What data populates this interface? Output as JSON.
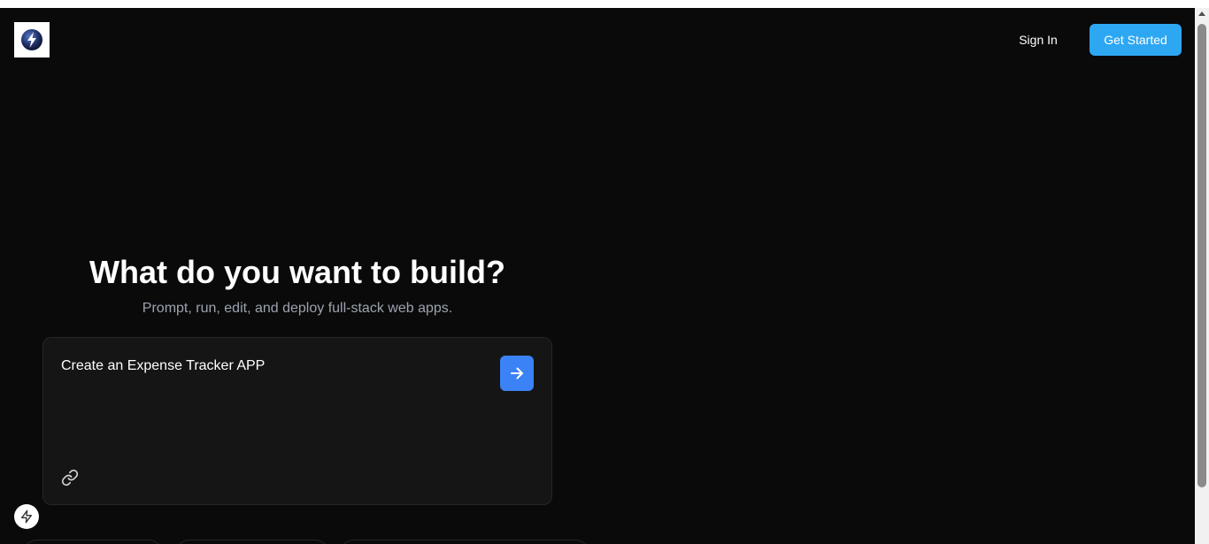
{
  "header": {
    "logo_icon": "lightning-bolt-logo-icon",
    "sign_in_label": "Sign In",
    "get_started_label": "Get Started"
  },
  "hero": {
    "title": "What do you want to build?",
    "subtitle": "Prompt, run, edit, and deploy full-stack web apps."
  },
  "prompt": {
    "value": "Create an Expense Tracker APP",
    "send_icon": "arrow-right-icon",
    "attach_icon": "link-icon"
  },
  "footer": {
    "badge_icon": "bolt-icon"
  },
  "colors": {
    "background": "#0a0a0a",
    "accent": "#2ea7f2",
    "send_button": "#3b82f6",
    "card": "#151515"
  }
}
